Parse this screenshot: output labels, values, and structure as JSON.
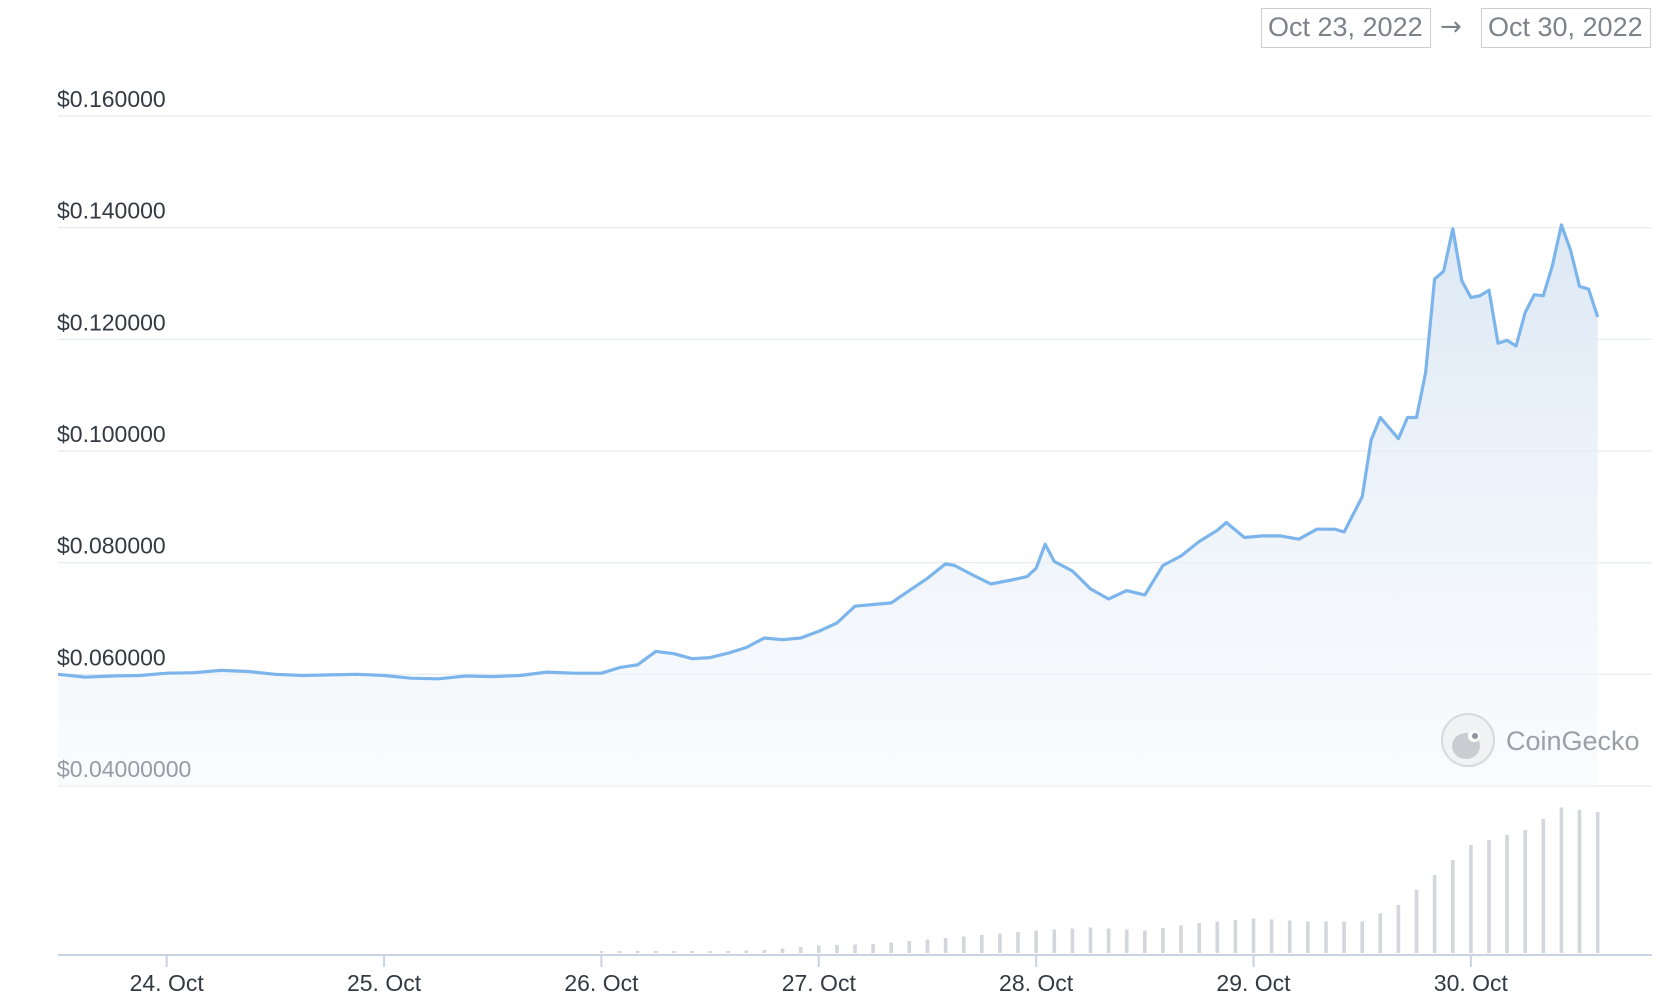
{
  "date_range": {
    "from": "Oct 23, 2022",
    "arrow": "→",
    "to": "Oct 30, 2022"
  },
  "watermark": {
    "brand": "CoinGecko",
    "icon": "gecko-logo-icon"
  },
  "colors": {
    "line": "#7cb5ec",
    "area_top": "#dbe7f4",
    "volume": "#d3d6db",
    "grid": "#e6e9ee",
    "axis": "#c9d3e3"
  },
  "chart_data": {
    "type": "line",
    "title": "",
    "xlabel": "",
    "ylabel": "",
    "ylim": [
      0.04,
      0.16
    ],
    "y_ticks": [
      {
        "value": 0.04,
        "label": "$0.04000000"
      },
      {
        "value": 0.06,
        "label": "$0.060000"
      },
      {
        "value": 0.08,
        "label": "$0.080000"
      },
      {
        "value": 0.1,
        "label": "$0.100000"
      },
      {
        "value": 0.12,
        "label": "$0.120000"
      },
      {
        "value": 0.14,
        "label": "$0.140000"
      },
      {
        "value": 0.16,
        "label": "$0.160000"
      }
    ],
    "x_range": [
      "2022-10-23T12:00",
      "2022-10-30T20:00"
    ],
    "x_ticks": [
      {
        "date": "2022-10-24",
        "label": "24. Oct"
      },
      {
        "date": "2022-10-25",
        "label": "25. Oct"
      },
      {
        "date": "2022-10-26",
        "label": "26. Oct"
      },
      {
        "date": "2022-10-27",
        "label": "27. Oct"
      },
      {
        "date": "2022-10-28",
        "label": "28. Oct"
      },
      {
        "date": "2022-10-29",
        "label": "29. Oct"
      },
      {
        "date": "2022-10-30",
        "label": "30. Oct"
      }
    ],
    "grid": true,
    "series": [
      {
        "kind": "price",
        "points": [
          [
            "2022-10-23T12:00",
            0.06
          ],
          [
            "2022-10-23T15:00",
            0.0595
          ],
          [
            "2022-10-23T18:00",
            0.0597
          ],
          [
            "2022-10-23T21:00",
            0.0598
          ],
          [
            "2022-10-24T00:00",
            0.0602
          ],
          [
            "2022-10-24T03:00",
            0.0603
          ],
          [
            "2022-10-24T06:00",
            0.0607
          ],
          [
            "2022-10-24T09:00",
            0.0605
          ],
          [
            "2022-10-24T12:00",
            0.06
          ],
          [
            "2022-10-24T15:00",
            0.0598
          ],
          [
            "2022-10-24T18:00",
            0.0599
          ],
          [
            "2022-10-24T21:00",
            0.06
          ],
          [
            "2022-10-25T00:00",
            0.0598
          ],
          [
            "2022-10-25T03:00",
            0.0593
          ],
          [
            "2022-10-25T06:00",
            0.0592
          ],
          [
            "2022-10-25T09:00",
            0.0597
          ],
          [
            "2022-10-25T12:00",
            0.0596
          ],
          [
            "2022-10-25T15:00",
            0.0598
          ],
          [
            "2022-10-25T18:00",
            0.0604
          ],
          [
            "2022-10-25T21:00",
            0.0602
          ],
          [
            "2022-10-26T00:00",
            0.0602
          ],
          [
            "2022-10-26T02:00",
            0.0612
          ],
          [
            "2022-10-26T04:00",
            0.0617
          ],
          [
            "2022-10-26T06:00",
            0.0641
          ],
          [
            "2022-10-26T08:00",
            0.0637
          ],
          [
            "2022-10-26T10:00",
            0.0628
          ],
          [
            "2022-10-26T12:00",
            0.063
          ],
          [
            "2022-10-26T14:00",
            0.0638
          ],
          [
            "2022-10-26T16:00",
            0.0648
          ],
          [
            "2022-10-26T18:00",
            0.0665
          ],
          [
            "2022-10-26T20:00",
            0.0662
          ],
          [
            "2022-10-26T22:00",
            0.0665
          ],
          [
            "2022-10-27T00:00",
            0.0677
          ],
          [
            "2022-10-27T02:00",
            0.0692
          ],
          [
            "2022-10-27T04:00",
            0.0722
          ],
          [
            "2022-10-27T06:00",
            0.0725
          ],
          [
            "2022-10-27T08:00",
            0.0728
          ],
          [
            "2022-10-27T10:00",
            0.075
          ],
          [
            "2022-10-27T12:00",
            0.0772
          ],
          [
            "2022-10-27T14:00",
            0.0798
          ],
          [
            "2022-10-27T15:00",
            0.0795
          ],
          [
            "2022-10-27T17:00",
            0.0778
          ],
          [
            "2022-10-27T19:00",
            0.0762
          ],
          [
            "2022-10-27T21:00",
            0.0768
          ],
          [
            "2022-10-27T23:00",
            0.0775
          ],
          [
            "2022-10-28T00:00",
            0.079
          ],
          [
            "2022-10-28T01:00",
            0.0833
          ],
          [
            "2022-10-28T02:00",
            0.0802
          ],
          [
            "2022-10-28T04:00",
            0.0785
          ],
          [
            "2022-10-28T06:00",
            0.0753
          ],
          [
            "2022-10-28T08:00",
            0.0735
          ],
          [
            "2022-10-28T10:00",
            0.075
          ],
          [
            "2022-10-28T12:00",
            0.0742
          ],
          [
            "2022-10-28T14:00",
            0.0795
          ],
          [
            "2022-10-28T16:00",
            0.0812
          ],
          [
            "2022-10-28T18:00",
            0.0838
          ],
          [
            "2022-10-28T20:00",
            0.0858
          ],
          [
            "2022-10-28T21:00",
            0.0872
          ],
          [
            "2022-10-28T23:00",
            0.0845
          ],
          [
            "2022-10-29T01:00",
            0.0848
          ],
          [
            "2022-10-29T03:00",
            0.0848
          ],
          [
            "2022-10-29T05:00",
            0.0842
          ],
          [
            "2022-10-29T07:00",
            0.086
          ],
          [
            "2022-10-29T09:00",
            0.086
          ],
          [
            "2022-10-29T10:00",
            0.0855
          ],
          [
            "2022-10-29T12:00",
            0.0918
          ],
          [
            "2022-10-29T13:00",
            0.102
          ],
          [
            "2022-10-29T14:00",
            0.106
          ],
          [
            "2022-10-29T16:00",
            0.1022
          ],
          [
            "2022-10-29T17:00",
            0.106
          ],
          [
            "2022-10-29T18:00",
            0.106
          ],
          [
            "2022-10-29T19:00",
            0.114
          ],
          [
            "2022-10-29T20:00",
            0.1308
          ],
          [
            "2022-10-29T21:00",
            0.1322
          ],
          [
            "2022-10-29T22:00",
            0.1398
          ],
          [
            "2022-10-29T23:00",
            0.1305
          ],
          [
            "2022-10-30T00:00",
            0.1275
          ],
          [
            "2022-10-30T01:00",
            0.1278
          ],
          [
            "2022-10-30T02:00",
            0.1288
          ],
          [
            "2022-10-30T03:00",
            0.1193
          ],
          [
            "2022-10-30T04:00",
            0.1198
          ],
          [
            "2022-10-30T05:00",
            0.1188
          ],
          [
            "2022-10-30T06:00",
            0.1248
          ],
          [
            "2022-10-30T07:00",
            0.128
          ],
          [
            "2022-10-30T08:00",
            0.1278
          ],
          [
            "2022-10-30T09:00",
            0.1332
          ],
          [
            "2022-10-30T10:00",
            0.1405
          ],
          [
            "2022-10-30T11:00",
            0.136
          ],
          [
            "2022-10-30T12:00",
            0.1295
          ],
          [
            "2022-10-30T13:00",
            0.129
          ],
          [
            "2022-10-30T14:00",
            0.124
          ]
        ]
      },
      {
        "kind": "volume",
        "unit": "relative",
        "points": [
          [
            "2022-10-26T00:00",
            0.01
          ],
          [
            "2022-10-26T06:00",
            0.01
          ],
          [
            "2022-10-26T12:00",
            0.01
          ],
          [
            "2022-10-26T18:00",
            0.02
          ],
          [
            "2022-10-27T00:00",
            0.05
          ],
          [
            "2022-10-27T06:00",
            0.06
          ],
          [
            "2022-10-27T12:00",
            0.09
          ],
          [
            "2022-10-27T18:00",
            0.12
          ],
          [
            "2022-10-28T00:00",
            0.15
          ],
          [
            "2022-10-28T06:00",
            0.17
          ],
          [
            "2022-10-28T12:00",
            0.15
          ],
          [
            "2022-10-28T18:00",
            0.2
          ],
          [
            "2022-10-29T00:00",
            0.23
          ],
          [
            "2022-10-29T06:00",
            0.21
          ],
          [
            "2022-10-29T12:00",
            0.21
          ],
          [
            "2022-10-29T16:00",
            0.32
          ],
          [
            "2022-10-29T20:00",
            0.52
          ],
          [
            "2022-10-30T00:00",
            0.72
          ],
          [
            "2022-10-30T06:00",
            0.82
          ],
          [
            "2022-10-30T10:00",
            0.97
          ],
          [
            "2022-10-30T14:00",
            0.94
          ]
        ]
      }
    ]
  }
}
